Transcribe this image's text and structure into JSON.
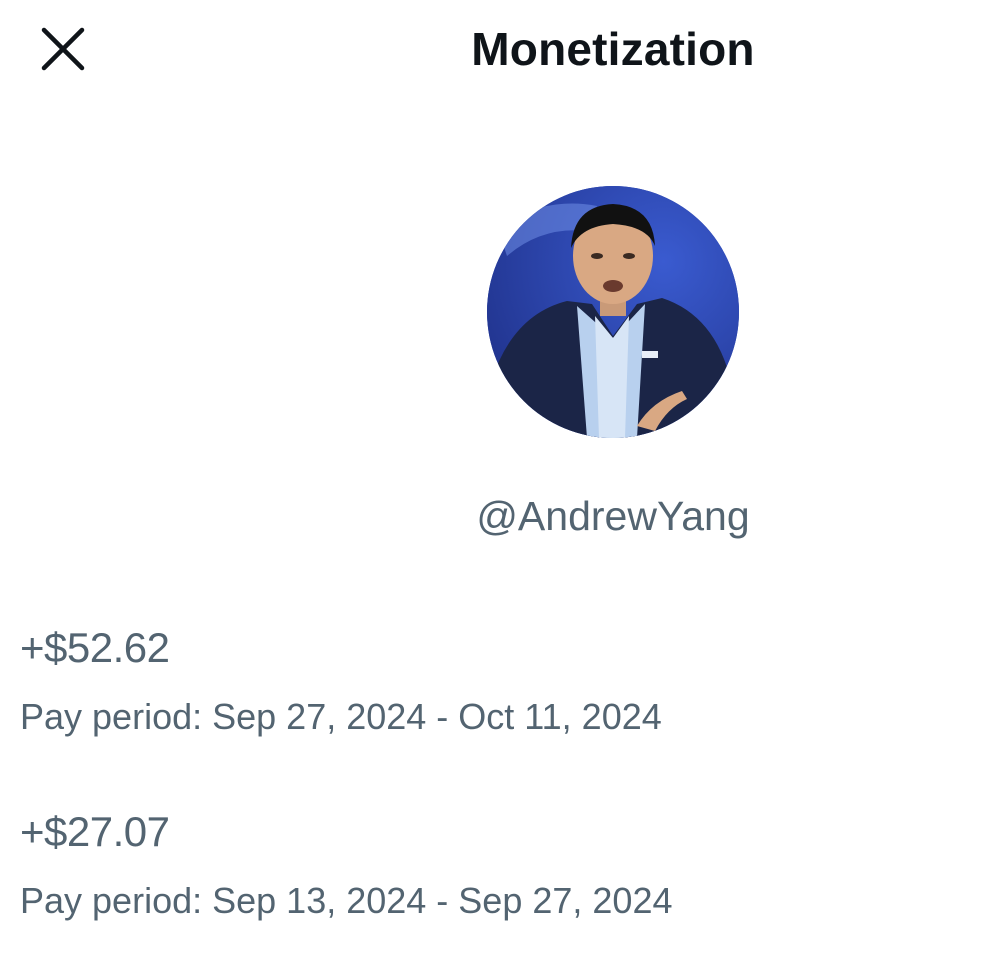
{
  "header": {
    "title": "Monetization",
    "close_icon": "close-icon"
  },
  "profile": {
    "handle": "@AndrewYang",
    "avatar_icon": "avatar-photo"
  },
  "payouts": [
    {
      "amount": "+$52.62",
      "period": "Pay period: Sep 27, 2024 - Oct 11, 2024"
    },
    {
      "amount": "+$27.07",
      "period": "Pay period: Sep 13, 2024 - Sep 27, 2024"
    }
  ],
  "colors": {
    "title": "#0f1419",
    "secondary_text": "#536471",
    "background": "#ffffff",
    "avatar_bg": "#2a44a8"
  }
}
